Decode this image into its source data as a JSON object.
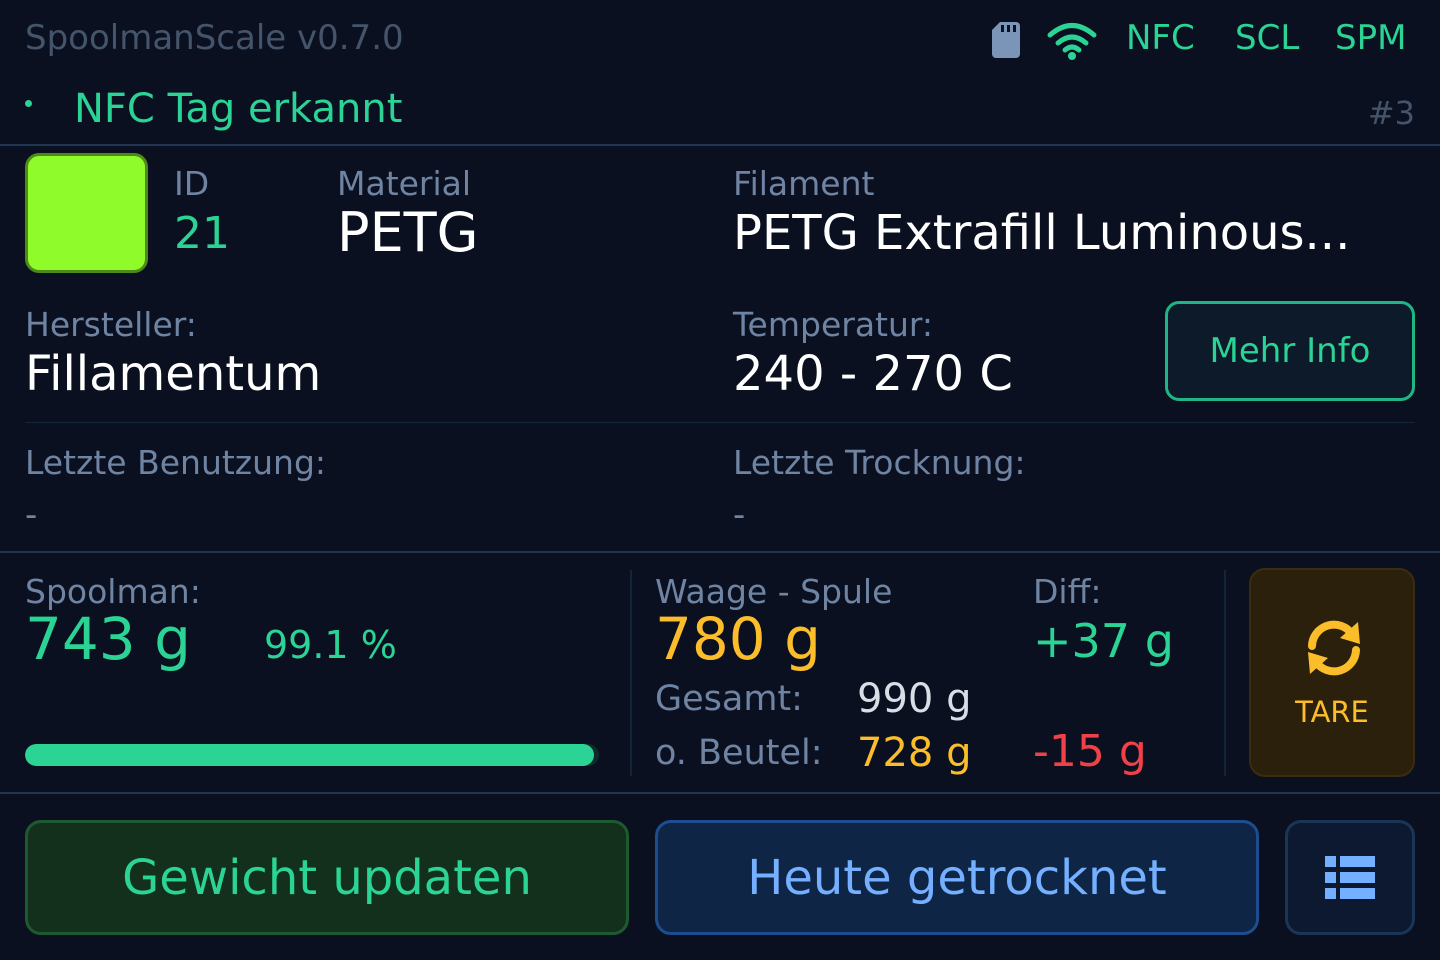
{
  "header": {
    "app_title": "SpoolmanScale v0.7.0",
    "status_items": [
      "NFC",
      "SCL",
      "SPM"
    ],
    "icons": [
      "sd-card-icon",
      "wifi-icon"
    ],
    "accent_color": "#2bd395"
  },
  "notice": {
    "message": "NFC Tag erkannt",
    "tag_number": "#3"
  },
  "spool": {
    "color_hex": "#8ffb2a",
    "id_label": "ID",
    "id_value": "21",
    "material_label": "Material",
    "material_value": "PETG",
    "filament_label": "Filament",
    "filament_value": "PETG Extrafill Luminous...",
    "vendor_label": "Hersteller:",
    "vendor_value": "Fillamentum",
    "temp_label": "Temperatur:",
    "temp_value": "240 - 270 C",
    "more_info_label": "Mehr Info",
    "last_used_label": "Letzte Benutzung:",
    "last_used_value": "-",
    "last_dried_label": "Letzte Trocknung:",
    "last_dried_value": "-"
  },
  "weights": {
    "spoolman_label": "Spoolman:",
    "spoolman_value": "743 g",
    "spoolman_percent": "99.1 %",
    "spoolman_fraction": 0.991,
    "scale_label": "Waage - Spule",
    "scale_value": "780 g",
    "diff_label": "Diff:",
    "diff_value": "+37 g",
    "total_label": "Gesamt:",
    "total_value": "990 g",
    "no_bag_label": "o. Beutel:",
    "no_bag_value": "728 g",
    "no_bag_diff": "-15 g"
  },
  "tare": {
    "label": "TARE",
    "icon": "refresh-icon"
  },
  "actions": {
    "update_weight": "Gewicht updaten",
    "dried_today": "Heute getrocknet",
    "menu_icon": "list-icon"
  }
}
